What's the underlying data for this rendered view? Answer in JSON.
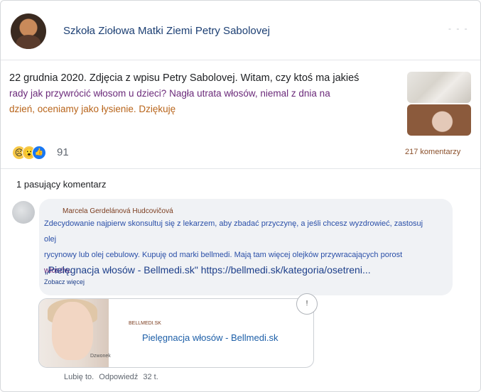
{
  "post": {
    "page_name": "Szkoła Ziołowa Matki Ziemi Petry Sabolovej",
    "more_label": "- - -",
    "text_line1": "22 grudnia 2020. Zdjęcia z wpisu Petry Sabolovej. Witam, czy ktoś ma jakieś",
    "text_line2": "rady jak przywrócić włosom u dzieci? Nagła utrata włosów, niemal z dnia na",
    "text_line3": "dzień, oceniamy jako łysienie. Dziękuję",
    "reaction_count": "91",
    "comment_count": "217 komentarzy"
  },
  "comments": {
    "matching_label": "1 pasujący komentarz",
    "item": {
      "author": "Marcela Gerdelánová Hudcovičová",
      "body_line1": "Zdecydowanie najpierw skonsultuj się z lekarzem, aby zbadać przyczynę, a jeśli chcesz wyzdrowieć, zastosuj olej",
      "body_line2": "rycynowy lub olej cebulowy. Kupuję od marki bellmedi. Mają tam więcej olejków przywracających porost",
      "body_line3": "włosów.",
      "link_text": "„Pielęgnacja włosów - Bellmedi.sk\" https://bellmedi.sk/kategoria/osetreni...",
      "see_more": "Zobacz więcej",
      "preview": {
        "domain": "BELLMEDI.SK",
        "title": "Pielęgnacja włosów - Bellmedi.sk",
        "image_caption": "Dzwonek",
        "info_icon": "info-icon"
      },
      "actions": {
        "like": "Lubię to.",
        "reply": "Odpowiedź",
        "time": "32 t."
      }
    }
  },
  "colors": {
    "page_name": "#1c3f73",
    "comment_text": "#2a4fa8",
    "accent_brown": "#8a4f2a"
  }
}
